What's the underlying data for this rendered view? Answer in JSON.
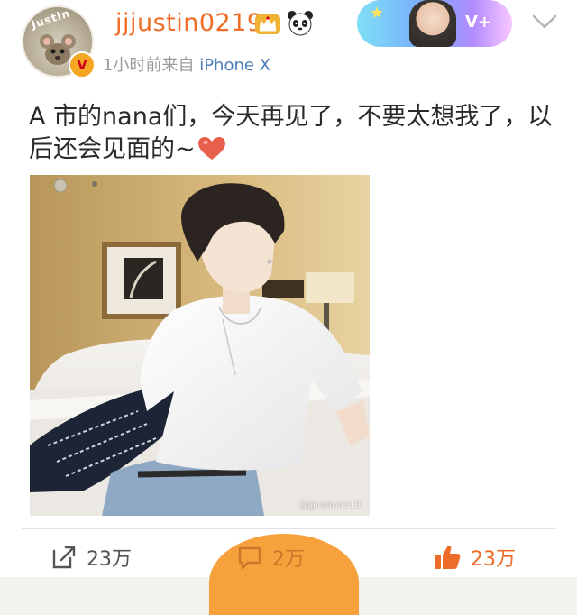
{
  "header": {
    "username": "jjjustin0219",
    "avatar_badge": "Justin",
    "time_label": "1小时前",
    "source_prefix": "来自",
    "device": "iPhone X",
    "vip_tag": "V+"
  },
  "post": {
    "text": "A 市的nana们，今天再见了，不要太想我了，以后还会见面的~",
    "watermark": "@jjjustin0219"
  },
  "actions": {
    "repost_count": "23万",
    "comment_count": "2万",
    "like_count": "23万"
  },
  "colors": {
    "username": "#f06d28",
    "device_link": "#4a7fb5",
    "like_accent": "#ef6b2a",
    "comment_bubble": "#f7a13c"
  },
  "icons": {
    "crown": "crown-icon",
    "panda": "panda-icon",
    "verified": "verified-badge-icon",
    "chevron": "chevron-down-icon",
    "heart": "heart-icon",
    "repost": "repost-icon",
    "comment": "comment-icon",
    "like": "thumbs-up-icon"
  }
}
